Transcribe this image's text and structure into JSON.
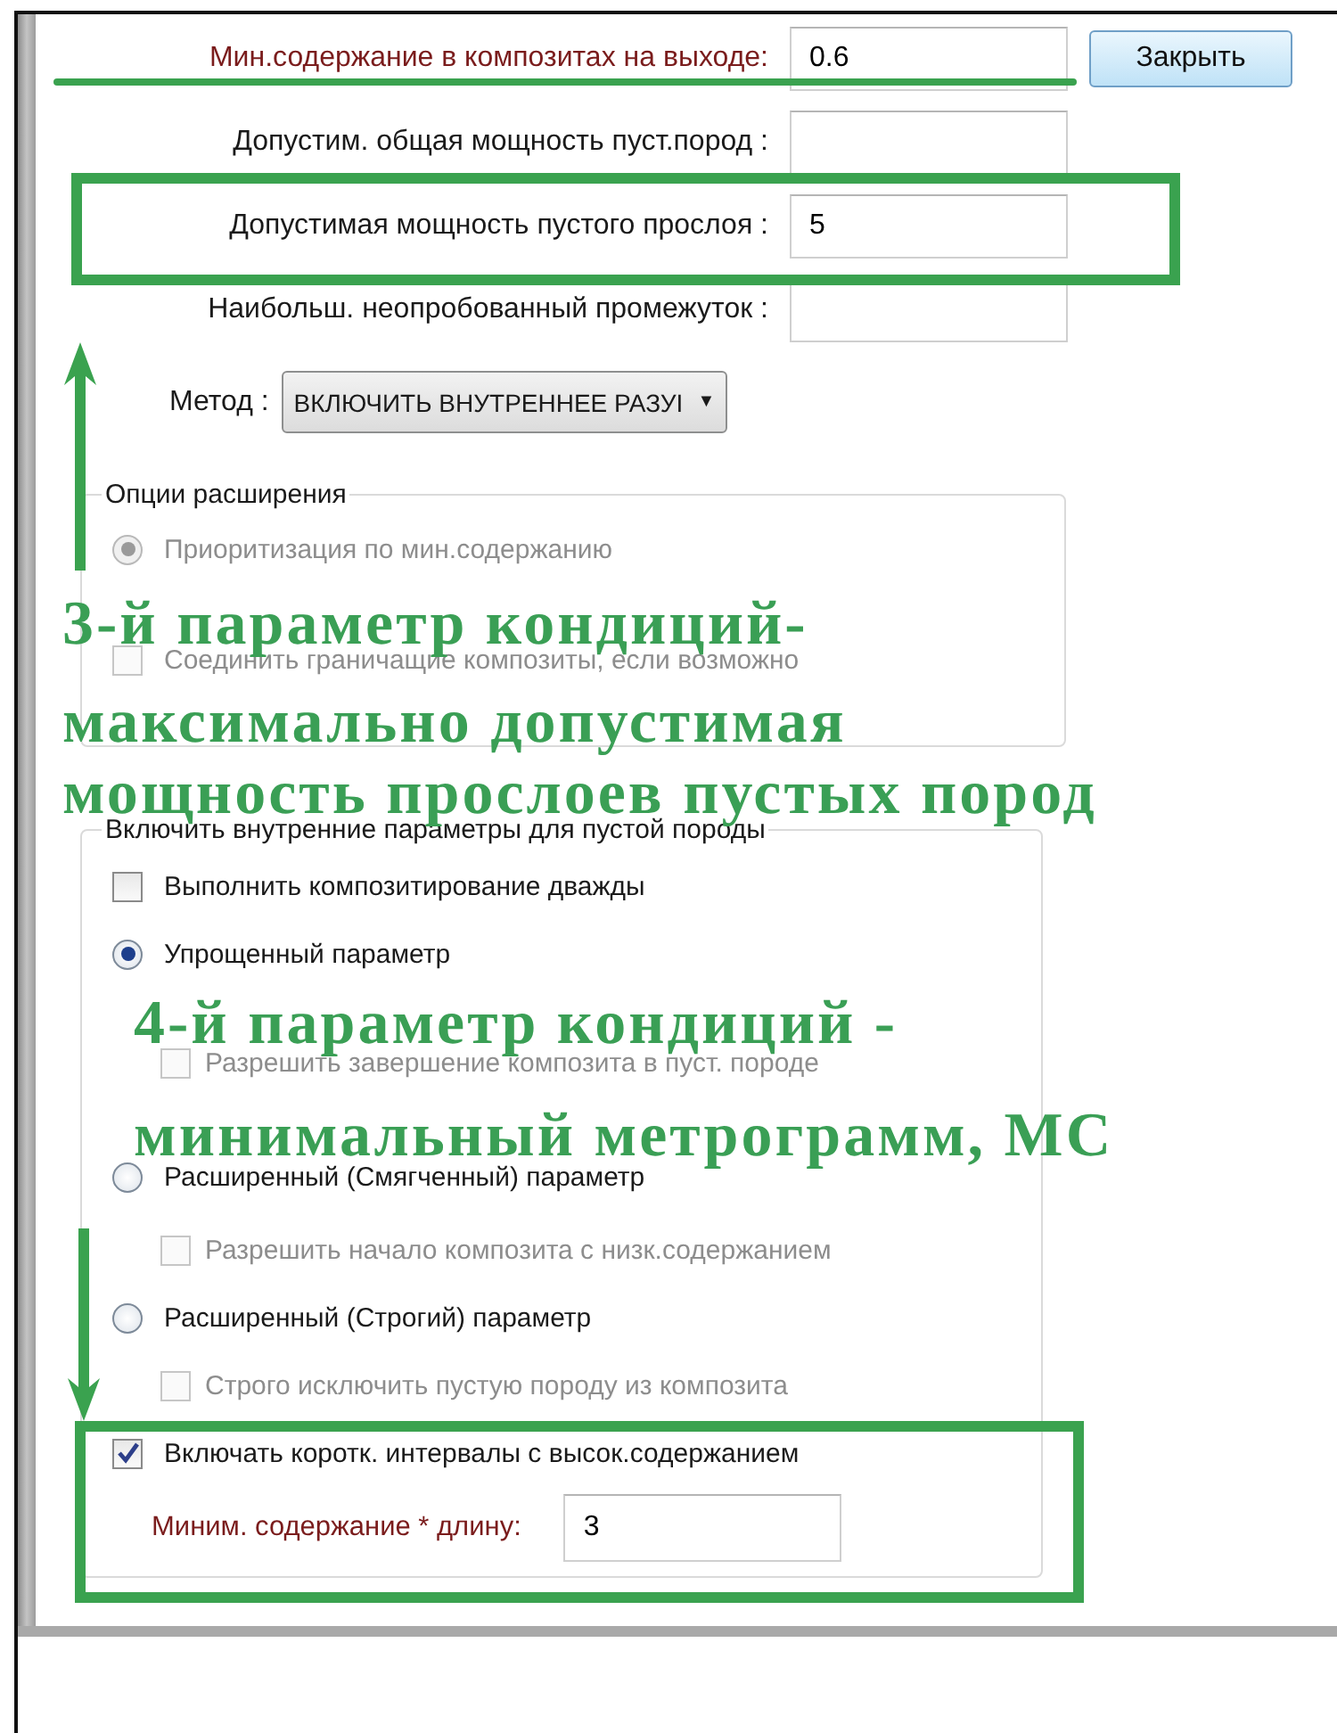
{
  "fields": [
    {
      "label": "Мин.содержание в композитах на выходе:",
      "value": "0.6",
      "color": "#7a1c1c"
    },
    {
      "label": "Допустим. общая мощность пуст.пород :",
      "color": "#1a1a1a"
    },
    {
      "label": "Допустимая мощность  пустого прослоя :",
      "value": "5",
      "color": "#1a1a1a"
    },
    {
      "label": "Наибольш. неопробованный промежуток :",
      "color": "#1a1a1a"
    }
  ],
  "close_button": {
    "label": "Закрыть"
  },
  "method": {
    "label": "Метод :",
    "value": "ВКЛЮЧИТЬ ВНУТРЕННЕЕ РАЗУI",
    "arrow": "▼"
  },
  "groups": [
    {
      "title": "Опции расширения",
      "items": [
        {
          "kind": "radio",
          "text": "Приоритизация по мин.содержанию",
          "selected": true,
          "disabled": true
        },
        {
          "kind": "gap"
        },
        {
          "kind": "checkbox",
          "text": "Соединить граничащие композиты, если возможно",
          "checked": false,
          "disabled": true
        }
      ]
    },
    {
      "title": "Включить внутренние параметры для пустой породы",
      "items": [
        {
          "kind": "checkbox",
          "text": "Выполнить композитирование дважды",
          "checked": false,
          "disabled": false
        },
        {
          "kind": "radio",
          "text": "Упрощенный параметр",
          "selected": true,
          "disabled": false,
          "children": [
            {
              "kind": "checkbox",
              "text": "Разрешить завершение композита в пуст. породе",
              "checked": false,
              "disabled": true
            }
          ]
        },
        {
          "kind": "radio",
          "text": "Расширенный (Смягченный) параметр",
          "selected": false,
          "disabled": false,
          "children": [
            {
              "kind": "checkbox",
              "text": "Разрешить начало композита с низк.содержанием",
              "checked": false,
              "disabled": true
            }
          ]
        },
        {
          "kind": "radio",
          "text": "Расширенный (Строгий) параметр",
          "selected": false,
          "disabled": false,
          "children": [
            {
              "kind": "checkbox",
              "text": "Строго исключить пустую породу из композита",
              "checked": false,
              "disabled": true
            }
          ]
        },
        {
          "kind": "checkbox",
          "text": "Включать коротк. интервалы с высок.содержанием",
          "checked": true,
          "disabled": false,
          "children": [
            {
              "kind": "field",
              "label": "Миним. содержание * длину:",
              "value": "3"
            }
          ]
        }
      ]
    }
  ],
  "annotations": [
    {
      "kind": "underline"
    },
    {
      "kind": "box"
    },
    {
      "kind": "box"
    },
    {
      "kind": "arrow"
    },
    {
      "kind": "arrow"
    },
    {
      "kind": "note",
      "lines": [
        "3-й параметр кондиций-",
        "максимально допустимая",
        "мощность прослоев пустых пород"
      ]
    },
    {
      "kind": "note",
      "lines": [
        "4-й параметр кондиций -",
        "минимальный метрограмм, МС"
      ]
    }
  ]
}
